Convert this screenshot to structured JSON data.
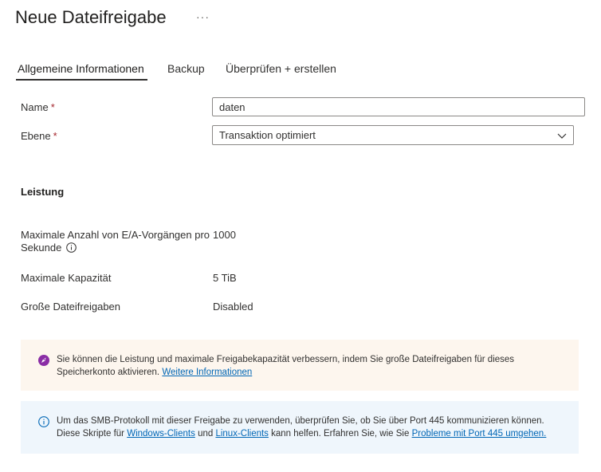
{
  "header": {
    "title": "Neue Dateifreigabe",
    "more": "···"
  },
  "tabs": [
    {
      "label": "Allgemeine Informationen",
      "active": true
    },
    {
      "label": "Backup",
      "active": false
    },
    {
      "label": "Überprüfen + erstellen",
      "active": false
    }
  ],
  "form": {
    "name_label": "Name",
    "name_value": "daten",
    "tier_label": "Ebene",
    "tier_value": "Transaktion optimiert",
    "required_mark": "*"
  },
  "performance": {
    "heading": "Leistung",
    "iops_label_line1": "Maximale Anzahl von E/A-Vorgängen pro",
    "iops_label_line2": "Sekunde",
    "iops_value": "1000",
    "capacity_label": "Maximale Kapazität",
    "capacity_value": "5 TiB",
    "large_shares_label": "Große Dateifreigaben",
    "large_shares_value": "Disabled"
  },
  "warn_banner": {
    "text": "Sie können die Leistung und maximale Freigabekapazität verbessern, indem Sie große Dateifreigaben für dieses Speicherkonto aktivieren.",
    "link": "Weitere Informationen"
  },
  "info_banner": {
    "line1": "Um das SMB-Protokoll mit dieser Freigabe zu verwenden, überprüfen Sie, ob Sie über Port 445 kommunizieren können.",
    "part1": "Diese Skripte für",
    "link_windows": "Windows-Clients",
    "part2": "und",
    "link_linux": "Linux-Clients",
    "part3": "kann helfen. Erfahren Sie, wie Sie",
    "link_port": "Probleme mit Port 445 umgehen."
  },
  "colors": {
    "accent_link": "#0066b5",
    "required": "#a4262c",
    "warn_bg": "#fdf6ee",
    "info_bg": "#eff6fc",
    "rocket_icon": "#8a2da5"
  }
}
